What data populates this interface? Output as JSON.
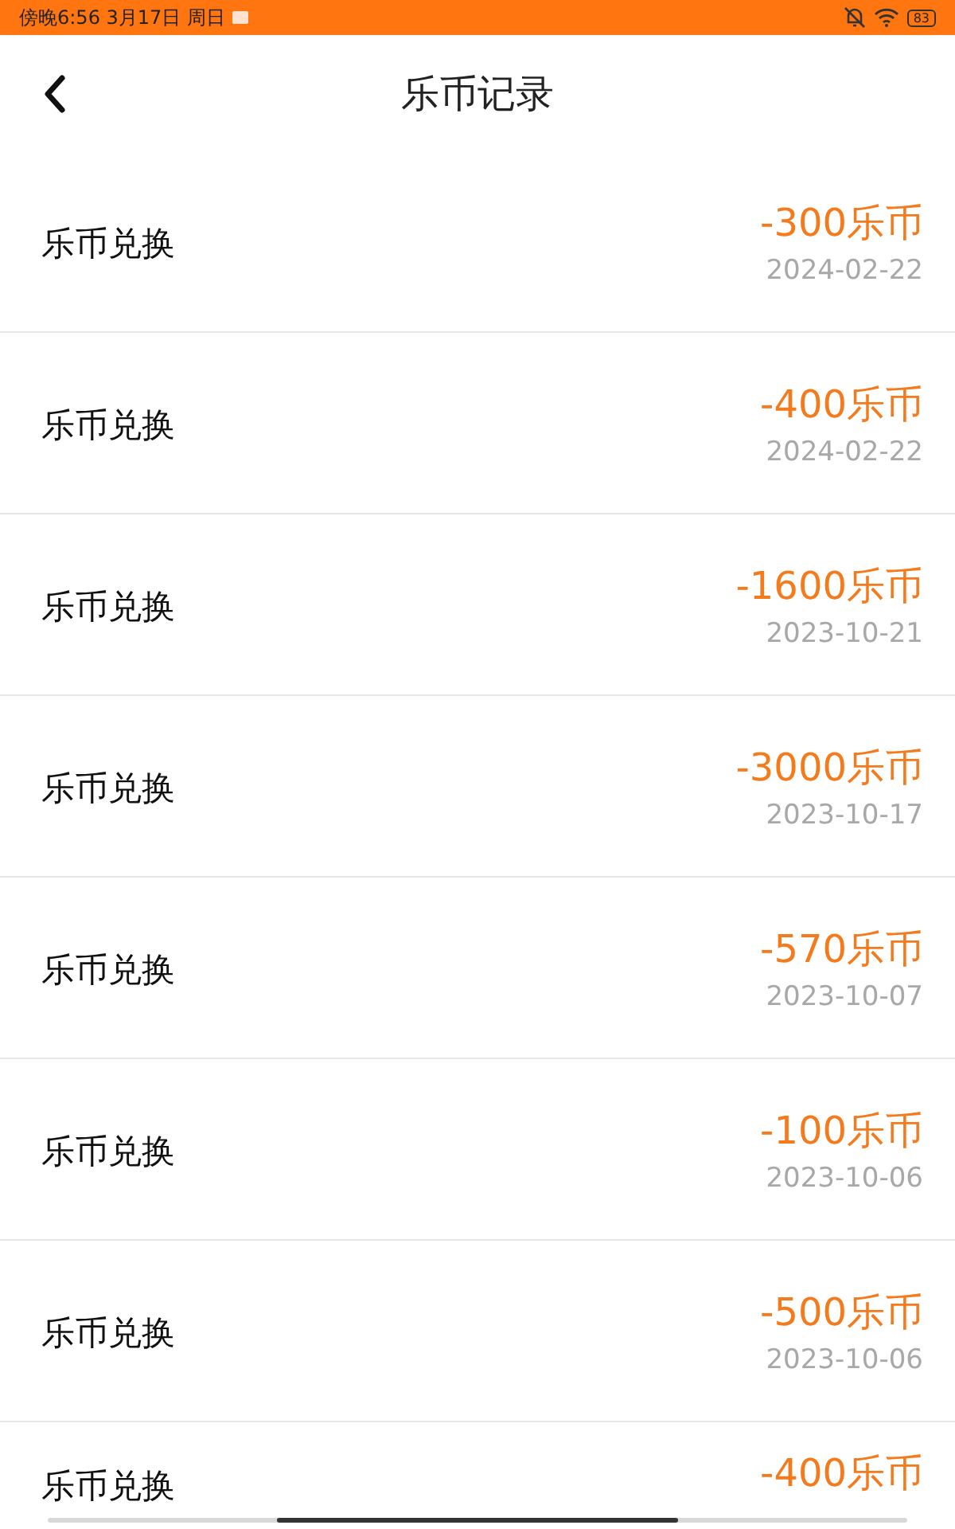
{
  "status_bar": {
    "time": "傍晚6:56 3月17日 周日",
    "battery": "83"
  },
  "header": {
    "title": "乐币记录"
  },
  "records": [
    {
      "label": "乐币兑换",
      "amount": "-300乐币",
      "date": "2024-02-22"
    },
    {
      "label": "乐币兑换",
      "amount": "-400乐币",
      "date": "2024-02-22"
    },
    {
      "label": "乐币兑换",
      "amount": "-1600乐币",
      "date": "2023-10-21"
    },
    {
      "label": "乐币兑换",
      "amount": "-3000乐币",
      "date": "2023-10-17"
    },
    {
      "label": "乐币兑换",
      "amount": "-570乐币",
      "date": "2023-10-07"
    },
    {
      "label": "乐币兑换",
      "amount": "-100乐币",
      "date": "2023-10-06"
    },
    {
      "label": "乐币兑换",
      "amount": "-500乐币",
      "date": "2023-10-06"
    },
    {
      "label": "乐币兑换",
      "amount": "-400乐币"
    }
  ]
}
